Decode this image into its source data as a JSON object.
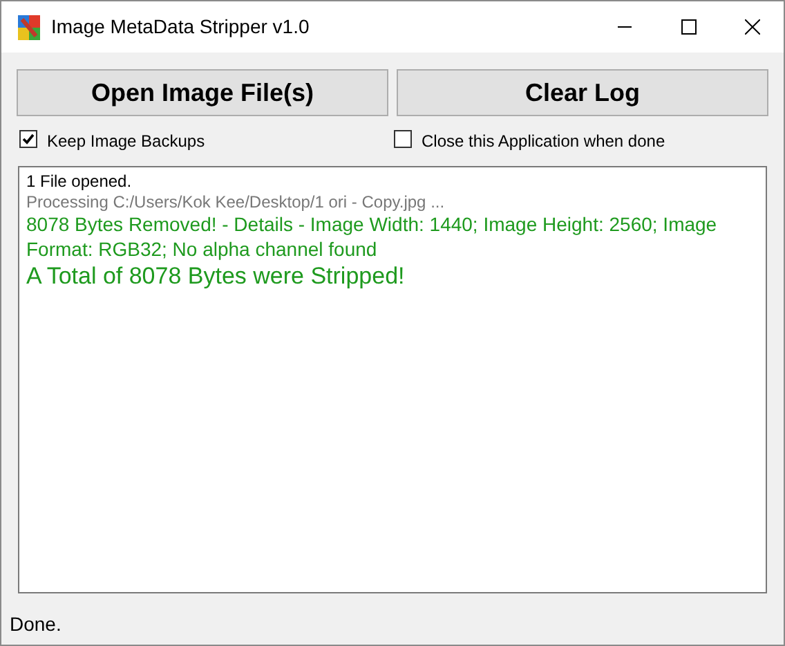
{
  "window": {
    "title": "Image MetaData Stripper v1.0"
  },
  "buttons": [
    "Open Image File(s)",
    "Clear Log"
  ],
  "options": [
    {
      "label": "Keep Image Backups",
      "checked": true
    },
    {
      "label": "Close this Application when done",
      "checked": false
    }
  ],
  "log": [
    {
      "kind": "info",
      "text": "1 File opened."
    },
    {
      "kind": "muted",
      "text": "Processing C:/Users/Kok Kee/Desktop/1 ori - Copy.jpg ..."
    },
    {
      "kind": "success",
      "text": "8078 Bytes Removed! - Details - Image Width: 1440; Image Height: 2560; Image Format: RGB32; No alpha channel found"
    },
    {
      "kind": "total",
      "text": "A Total of 8078 Bytes were Stripped!"
    }
  ],
  "status_bar": "Done."
}
